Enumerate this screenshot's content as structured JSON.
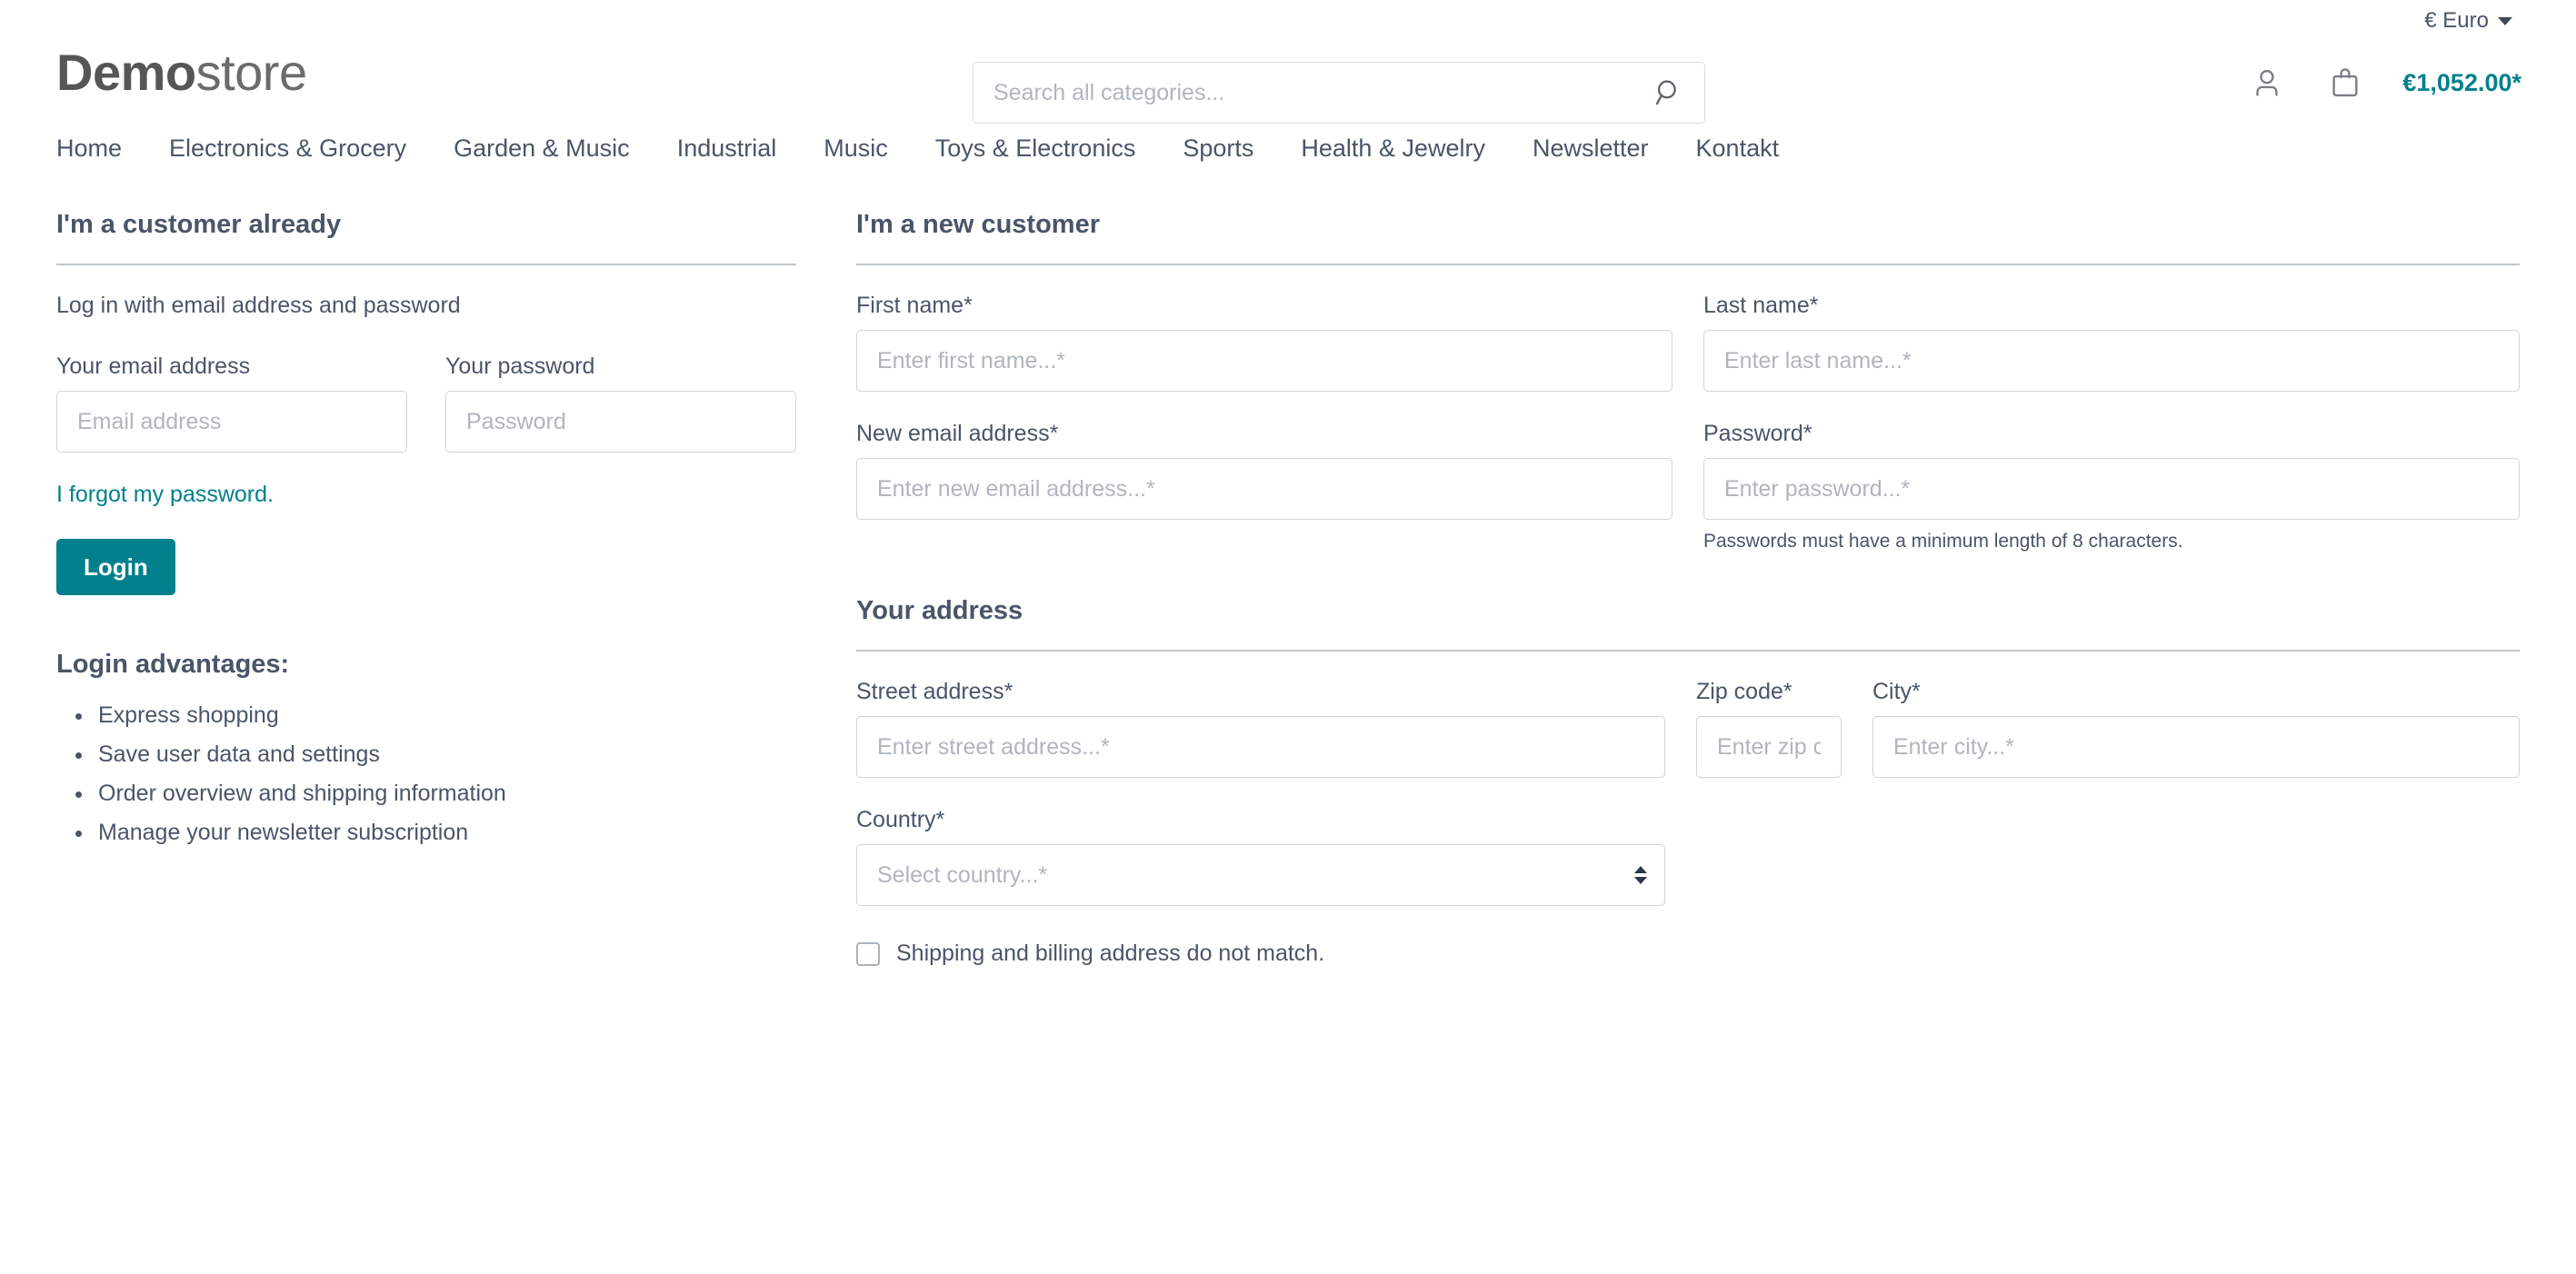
{
  "topbar": {
    "currency_label": "€ Euro"
  },
  "header": {
    "logo_bold": "Demo",
    "logo_light": "store",
    "search_placeholder": "Search all categories...",
    "cart_total": "€1,052.00*"
  },
  "nav": {
    "items": [
      {
        "label": "Home"
      },
      {
        "label": "Electronics & Grocery"
      },
      {
        "label": "Garden & Music"
      },
      {
        "label": "Industrial"
      },
      {
        "label": "Music"
      },
      {
        "label": "Toys & Electronics"
      },
      {
        "label": "Sports"
      },
      {
        "label": "Health & Jewelry"
      },
      {
        "label": "Newsletter"
      },
      {
        "label": "Kontakt"
      }
    ]
  },
  "login": {
    "title": "I'm a customer already",
    "lead": "Log in with email address and password",
    "email_label": "Your email address",
    "email_placeholder": "Email address",
    "password_label": "Your password",
    "password_placeholder": "Password",
    "forgot_link": "I forgot my password.",
    "submit_label": "Login",
    "advantages_title": "Login advantages:",
    "advantages": [
      "Express shopping",
      "Save user data and settings",
      "Order overview and shipping information",
      "Manage your newsletter subscription"
    ]
  },
  "register": {
    "title": "I'm a new customer",
    "first_name_label": "First name*",
    "first_name_placeholder": "Enter first name...*",
    "last_name_label": "Last name*",
    "last_name_placeholder": "Enter last name...*",
    "email_label": "New email address*",
    "email_placeholder": "Enter new email address...*",
    "password_label": "Password*",
    "password_placeholder": "Enter password...*",
    "password_hint": "Passwords must have a minimum length of 8 characters.",
    "address_title": "Your address",
    "street_label": "Street address*",
    "street_placeholder": "Enter street address...*",
    "zip_label": "Zip code*",
    "zip_placeholder": "Enter zip code...*",
    "city_label": "City*",
    "city_placeholder": "Enter city...*",
    "country_label": "Country*",
    "country_placeholder": "Select country...*",
    "shipping_checkbox_label": "Shipping and billing address do not match."
  },
  "colors": {
    "accent_teal": "#00808c",
    "text_slate": "#4a5568",
    "border_gray": "#cfd5da",
    "placeholder_gray": "#b0b6bd"
  },
  "icons": {
    "search": "search-icon",
    "account": "account-icon",
    "cart": "shopping-bag-icon",
    "chevron_down": "chevron-down-icon"
  }
}
